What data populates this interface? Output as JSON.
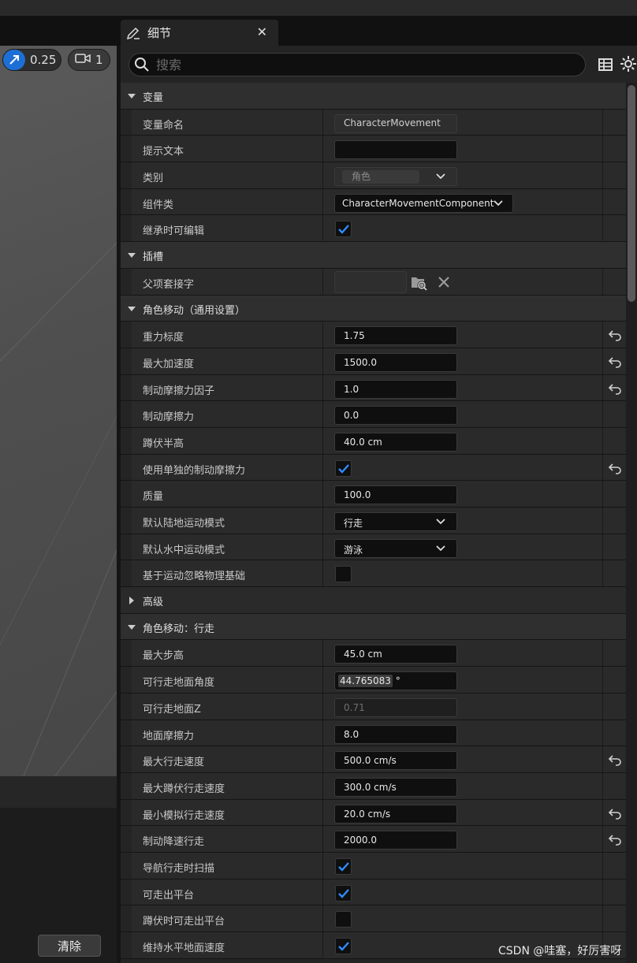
{
  "viewport_toolbar": {
    "scale_value": "0.25",
    "camera_speed": "1"
  },
  "log": {
    "clear_label": "清除"
  },
  "details": {
    "tab_title": "细节",
    "search_placeholder": "搜索"
  },
  "sections": {
    "variable": {
      "title": "变量",
      "var_name_label": "变量命名",
      "var_name_value": "CharacterMovement",
      "tooltip_label": "提示文本",
      "tooltip_value": "",
      "category_label": "类别",
      "category_value": "角色",
      "component_class_label": "组件类",
      "component_class_value": "CharacterMovementComponent",
      "editable_label": "继承时可编辑"
    },
    "sockets": {
      "title": "插槽",
      "parent_socket_label": "父项套接字"
    },
    "general": {
      "title": "角色移动（通用设置）",
      "gravity_label": "重力标度",
      "gravity_value": "1.75",
      "max_accel_label": "最大加速度",
      "max_accel_value": "1500.0",
      "brake_factor_label": "制动摩擦力因子",
      "brake_factor_value": "1.0",
      "brake_friction_label": "制动摩擦力",
      "brake_friction_value": "0.0",
      "crouch_half_label": "蹲伏半高",
      "crouch_half_value": "40.0 cm",
      "separate_brake_label": "使用单独的制动摩擦力",
      "mass_label": "质量",
      "mass_value": "100.0",
      "ground_mode_label": "默认陆地运动模式",
      "ground_mode_value": "行走",
      "water_mode_label": "默认水中运动模式",
      "water_mode_value": "游泳",
      "ignore_base_label": "基于运动忽略物理基础"
    },
    "advanced": {
      "title": "高级"
    },
    "walking": {
      "title": "角色移动：行走",
      "step_height_label": "最大步高",
      "step_height_value": "45.0 cm",
      "floor_angle_label": "可行走地面角度",
      "floor_angle_value": "44.765083",
      "floor_angle_unit": "°",
      "floor_z_label": "可行走地面Z",
      "floor_z_value": "0.71",
      "ground_friction_label": "地面摩擦力",
      "ground_friction_value": "8.0",
      "max_walk_label": "最大行走速度",
      "max_walk_value": "500.0 cm/s",
      "max_crouch_walk_label": "最大蹲伏行走速度",
      "max_crouch_walk_value": "300.0 cm/s",
      "min_analog_label": "最小模拟行走速度",
      "min_analog_value": "20.0 cm/s",
      "brake_decel_label": "制动降速行走",
      "brake_decel_value": "2000.0",
      "nav_sweep_label": "导航行走时扫描",
      "ledge_label": "可走出平台",
      "crouch_ledge_label": "蹲伏时可走出平台",
      "maintain_velocity_label": "维持水平地面速度"
    }
  },
  "watermark": "CSDN @哇塞，好厉害呀"
}
